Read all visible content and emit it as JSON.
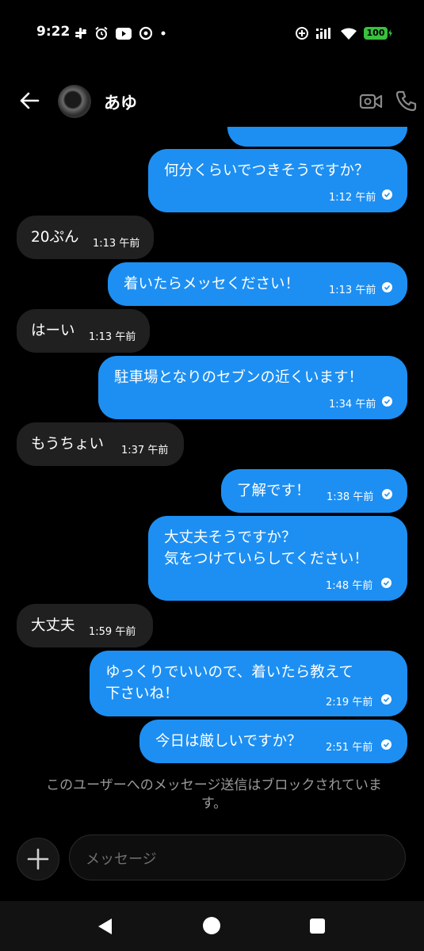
{
  "status_bar": {
    "time": "9:22",
    "battery": "100"
  },
  "header": {
    "contact_name": "あゆ"
  },
  "messages": [
    {
      "dir": "out",
      "text": "何分くらいでつきそうですか？",
      "time": "1:12 午前"
    },
    {
      "dir": "in",
      "text": "20ぷん",
      "time": "1:13 午前"
    },
    {
      "dir": "out",
      "text": "着いたらメッセください！",
      "time": "1:13 午前"
    },
    {
      "dir": "in",
      "text": "はーい",
      "time": "1:13 午前"
    },
    {
      "dir": "out",
      "text": "駐車場となりのセブンの近くいます！",
      "time": "1:34 午前"
    },
    {
      "dir": "in",
      "text": "もうちょい",
      "time": "1:37 午前"
    },
    {
      "dir": "out",
      "text": "了解です！",
      "time": "1:38 午前"
    },
    {
      "dir": "out",
      "line1": "大丈夫そうですか？",
      "line2": "気をつけていらしてください！",
      "time": "1:48 午前"
    },
    {
      "dir": "in",
      "text": "大丈夫",
      "time": "1:59 午前"
    },
    {
      "dir": "out",
      "line1": "ゆっくりでいいので、着いたら教えて",
      "line2": "下さいね！",
      "time": "2:19 午前"
    },
    {
      "dir": "out",
      "text": "今日は厳しいですか？",
      "time": "2:51 午前"
    }
  ],
  "notice": {
    "line1": "このユーザーへのメッセージ送信はブロックされていま",
    "line2": "す。"
  },
  "composer": {
    "placeholder": "メッセージ"
  },
  "colors": {
    "outgoing_bubble": "#1d8ff2",
    "incoming_bubble": "#202020",
    "background": "#000000"
  },
  "icons": [
    "back-arrow-icon",
    "video-camera-icon",
    "phone-icon",
    "plus-icon",
    "read-check-icon"
  ]
}
